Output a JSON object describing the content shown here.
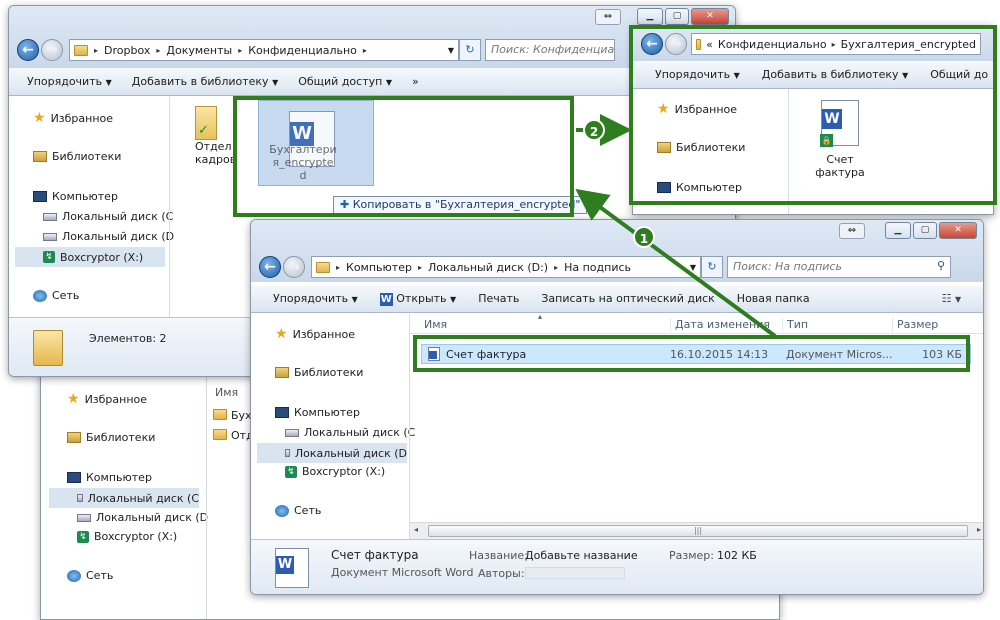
{
  "win1": {
    "address": [
      "Dropbox",
      "Документы",
      "Конфиденциально"
    ],
    "search_placeholder": "Поиск: Конфиденциально",
    "toolbar": {
      "organize": "Упорядочить",
      "add_library": "Добавить в библиотеку",
      "share": "Общий доступ",
      "more": "»"
    },
    "nav": {
      "favorites": "Избранное",
      "libraries": "Библиотеки",
      "computer": "Компьютер",
      "disk_c": "Локальный диск (C",
      "disk_d": "Локальный диск (D",
      "boxcryptor": "Boxcryptor (X:)",
      "network": "Сеть"
    },
    "file1_lines": [
      "Отдел",
      "кадров"
    ],
    "status": "Элементов: 2"
  },
  "drag": {
    "ghost_lines": [
      "Бухгалтери",
      "я_encrypte",
      "d"
    ],
    "tooltip": "Копировать в \"Бухгалтерия_encrypted\""
  },
  "win2": {
    "address_prefix": "«",
    "address": [
      "Конфиденциально",
      "Бухгалтерия_encrypted"
    ],
    "toolbar": {
      "organize": "Упорядочить",
      "add_library": "Добавить в библиотеку",
      "share": "Общий до"
    },
    "nav": {
      "favorites": "Избранное",
      "libraries": "Библиотеки",
      "computer": "Компьютер"
    },
    "file_lines": [
      "Счет",
      "фактура"
    ]
  },
  "win3": {
    "address": [
      "Компьютер",
      "Локальный диск (D:)",
      "На подпись"
    ],
    "search_placeholder": "Поиск: На подпись",
    "toolbar": {
      "organize": "Упорядочить",
      "open": "Открыть",
      "print": "Печать",
      "burn": "Записать на оптический диск",
      "new_folder": "Новая папка"
    },
    "columns": {
      "name": "Имя",
      "date": "Дата изменения",
      "type": "Тип",
      "size": "Размер"
    },
    "row": {
      "name": "Счет фактура",
      "date": "16.10.2015 14:13",
      "type": "Документ Micros...",
      "size": "103 КБ"
    },
    "nav": {
      "favorites": "Избранное",
      "libraries": "Библиотеки",
      "computer": "Компьютер",
      "disk_c": "Локальный диск (C",
      "disk_d": "Локальный диск (D",
      "boxcryptor": "Boxcryptor (X:)",
      "network": "Сеть"
    },
    "scroll_mid": "|||",
    "details": {
      "name": "Счет фактура",
      "kind": "Документ Microsoft Word",
      "title_label": "Название:",
      "title_value": "Добавьте название",
      "authors_label": "Авторы:",
      "size_label": "Размер:",
      "size_value": "102 КБ"
    }
  },
  "back_win": {
    "col_name": "Имя",
    "files": [
      "Бух",
      "Отд"
    ],
    "nav": {
      "favorites": "Избранное",
      "libraries": "Библиотеки",
      "computer": "Компьютер",
      "disk_c": "Локальный диск (C",
      "disk_d": "Локальный диск (D",
      "boxcryptor": "Boxcryptor (X:)",
      "network": "Сеть"
    }
  },
  "callouts": {
    "step1": "1",
    "step2": "2"
  },
  "colors": {
    "highlight": "#2e7d1e",
    "selection": "#cce8ff"
  }
}
